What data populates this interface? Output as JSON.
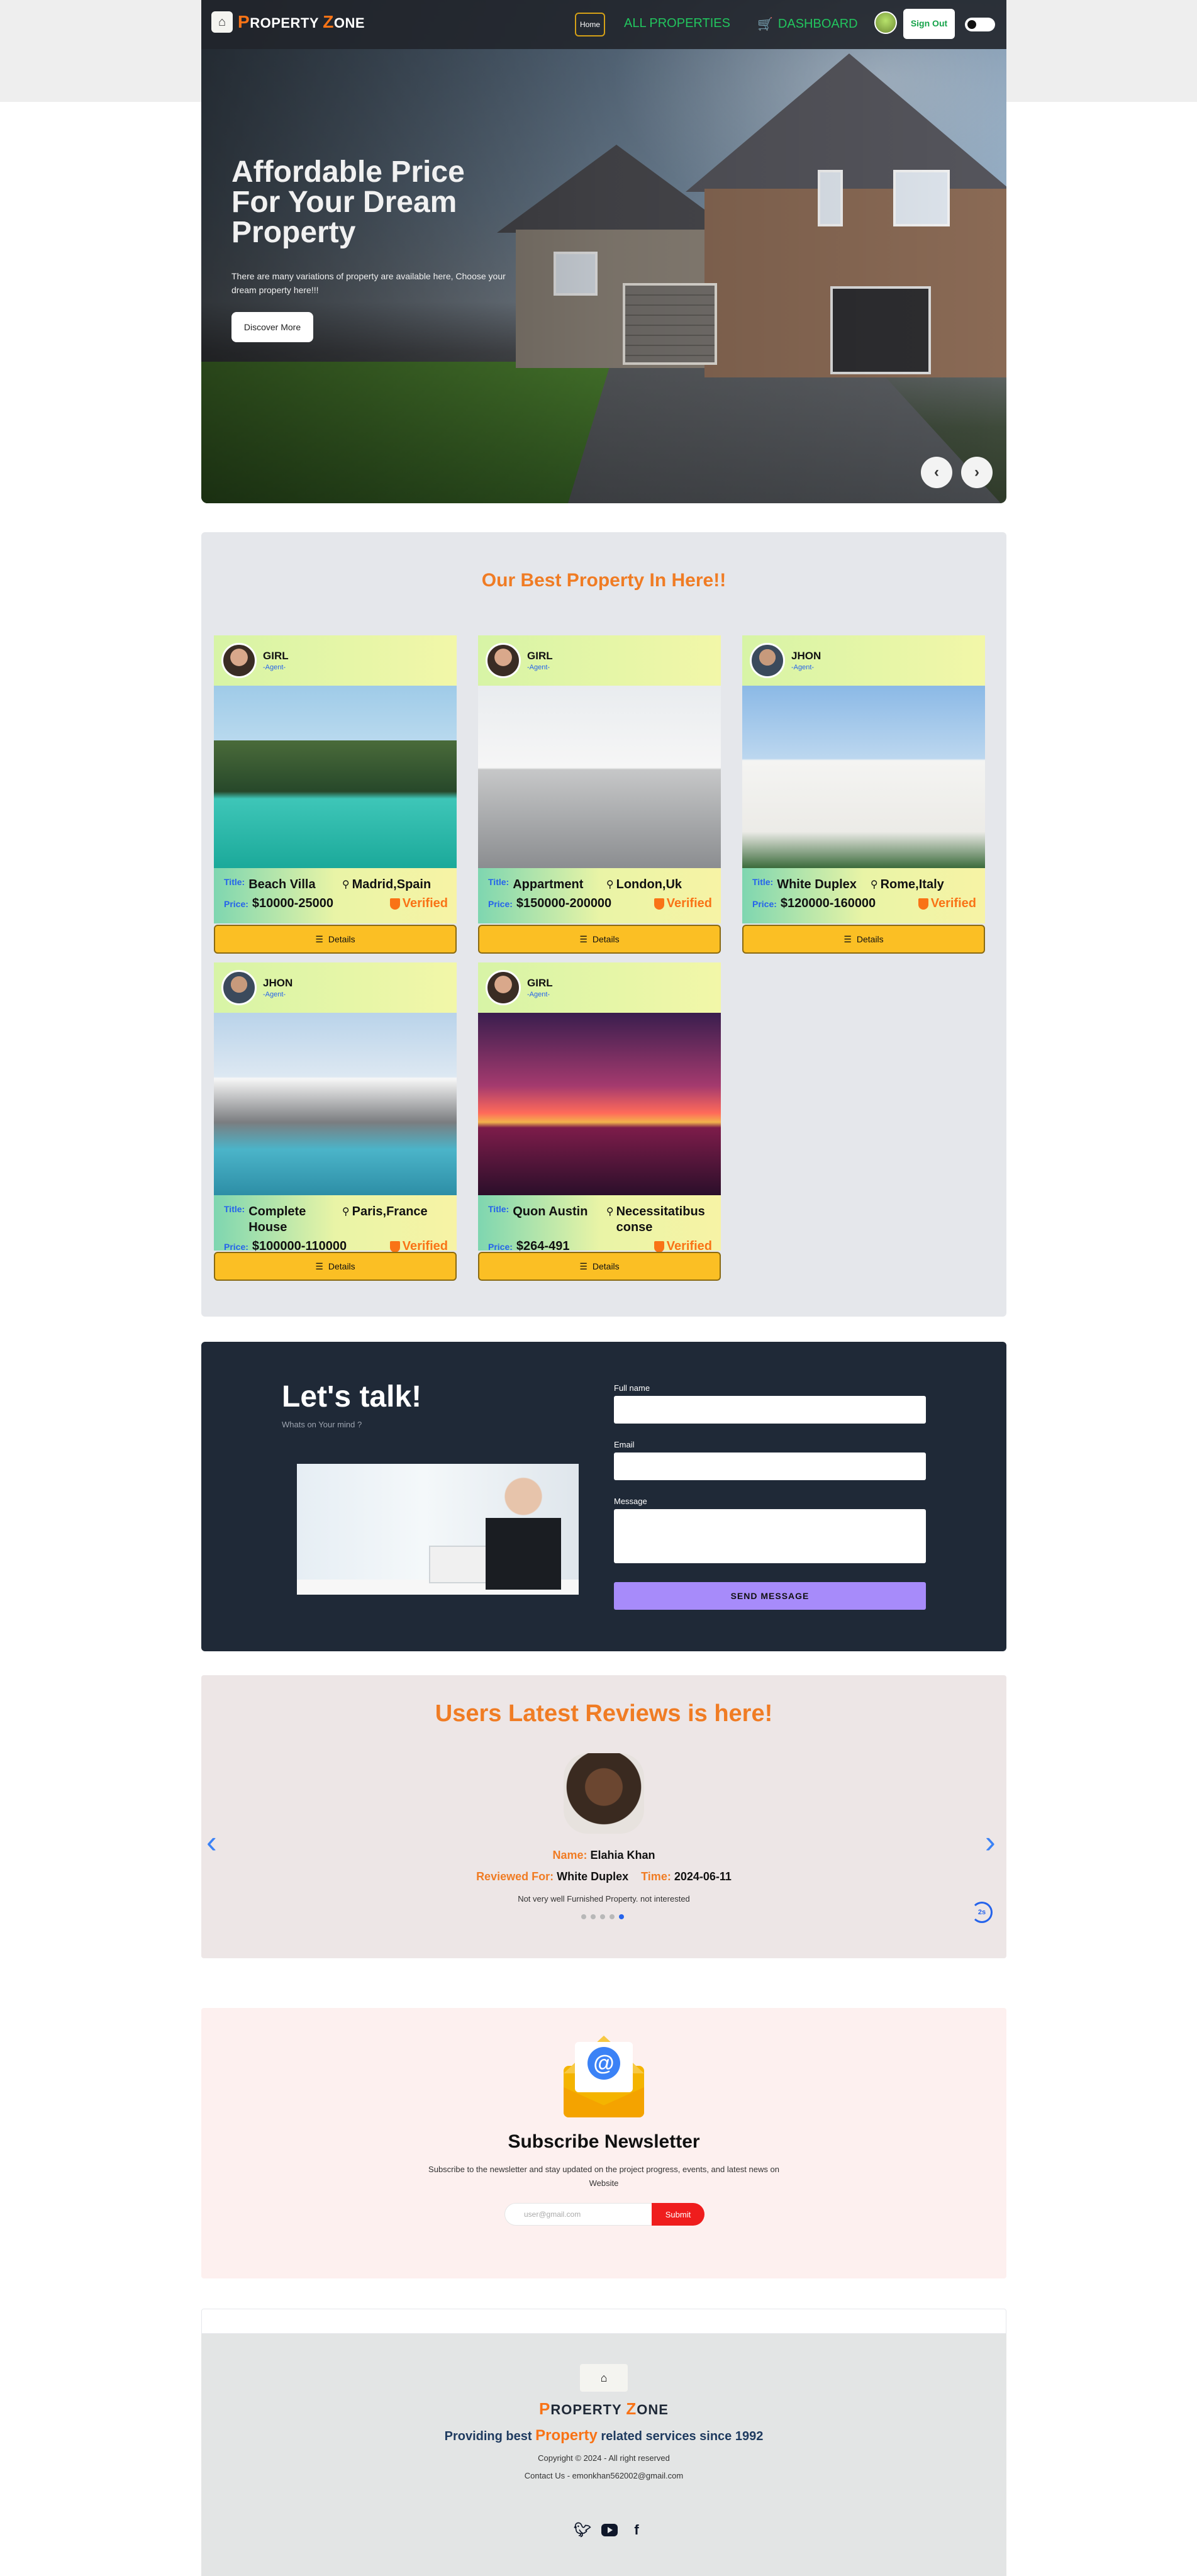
{
  "navbar": {
    "logo_first": "P",
    "logo_rest_1": "ROPERTY ",
    "logo_z": "Z",
    "logo_rest_2": "ONE",
    "home": "Home",
    "all_properties": "ALL PROPERTIES",
    "dashboard": "DASHBOARD",
    "sign_out": "Sign Out"
  },
  "hero": {
    "title": "Affordable Price For Your Dream Property",
    "description": "There are many variations of property are available here, Choose your dream property here!!!",
    "button": "Discover More",
    "prev": "‹",
    "next": "›"
  },
  "properties": {
    "heading": "Our Best Property In Here!!",
    "title_label": "Title:",
    "price_label": "Price:",
    "details_label": "Details",
    "cards": [
      {
        "agent": "GIRL",
        "role": "-Agent-",
        "title": "Beach Villa",
        "location": "Madrid,Spain",
        "price": "$10000-25000",
        "status": "Verified"
      },
      {
        "agent": "GIRL",
        "role": "-Agent-",
        "title": "Appartment",
        "location": "London,Uk",
        "price": "$150000-200000",
        "status": "Verified"
      },
      {
        "agent": "JHON",
        "role": "-Agent-",
        "title": "White Duplex",
        "location": "Rome,Italy",
        "price": "$120000-160000",
        "status": "Verified"
      },
      {
        "agent": "JHON",
        "role": "-Agent-",
        "title": "Complete House",
        "location": "Paris,France",
        "price": "$100000-110000",
        "status": "Verified"
      },
      {
        "agent": "GIRL",
        "role": "-Agent-",
        "title": "Quon Austin",
        "location": "Necessitatibus conse",
        "price": "$264-491",
        "status": "Verified"
      }
    ]
  },
  "contact": {
    "title": "Let's talk!",
    "subtitle": "Whats on Your mind ?",
    "full_name_label": "Full name",
    "email_label": "Email",
    "message_label": "Message",
    "send_button": "SEND MESSAGE"
  },
  "reviews": {
    "heading": "Users Latest Reviews is here!",
    "name_label": "Name:",
    "name": "Elahia Khan",
    "reviewed_for_label": "Reviewed For:",
    "reviewed_for": "White Duplex",
    "time_label": "Time:",
    "time": "2024-06-11",
    "text": "Not very well Furnished Property. not interested",
    "timer": "2s",
    "prev": "‹",
    "next": "›",
    "total_slides": 5,
    "active_slide": 5
  },
  "newsletter": {
    "title": "Subscribe Newsletter",
    "description": "Subscribe to the newsletter and stay updated on the project progress, events, and latest news on Website",
    "placeholder": "user@gmail.com",
    "button": "Submit"
  },
  "footer": {
    "logo_first": "P",
    "logo_rest_1": "ROPERTY ",
    "logo_z": "Z",
    "logo_rest_2": "ONE",
    "tag_before": "Providing best ",
    "tag_accent": "Property",
    "tag_after": " related services since 1992",
    "copyright": "Copyright © 2024 - All right reserved",
    "contact": "Contact Us - emonkhan562002@gmail.com",
    "social": [
      "twitter-icon",
      "youtube-icon",
      "facebook-icon"
    ]
  },
  "colors": {
    "accent_orange": "#f07c24",
    "nav_green": "#22c55e",
    "details_yellow": "#fbbf24",
    "send_purple": "#a78bfa",
    "submit_red": "#ef1d1d"
  }
}
